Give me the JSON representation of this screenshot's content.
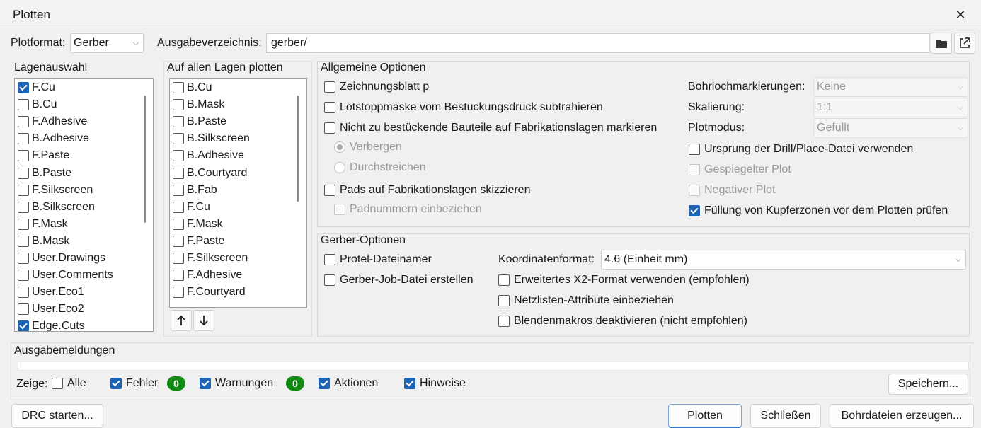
{
  "window": {
    "title": "Plotten",
    "close_glyph": "✕"
  },
  "header": {
    "plotformat_label": "Plotformat:",
    "plotformat_value": "Gerber",
    "ausgabe_label": "Ausgabeverzeichnis:",
    "ausgabe_value": "gerber/",
    "folder_icon": "folder-icon",
    "open_icon": "external-link-icon"
  },
  "lagenauswahl": {
    "heading": "Lagenauswahl",
    "items": [
      {
        "label": "F.Cu",
        "checked": true
      },
      {
        "label": "B.Cu",
        "checked": false
      },
      {
        "label": "F.Adhesive",
        "checked": false
      },
      {
        "label": "B.Adhesive",
        "checked": false
      },
      {
        "label": "F.Paste",
        "checked": false
      },
      {
        "label": "B.Paste",
        "checked": false
      },
      {
        "label": "F.Silkscreen",
        "checked": false
      },
      {
        "label": "B.Silkscreen",
        "checked": false
      },
      {
        "label": "F.Mask",
        "checked": false
      },
      {
        "label": "B.Mask",
        "checked": false
      },
      {
        "label": "User.Drawings",
        "checked": false
      },
      {
        "label": "User.Comments",
        "checked": false
      },
      {
        "label": "User.Eco1",
        "checked": false
      },
      {
        "label": "User.Eco2",
        "checked": false
      },
      {
        "label": "Edge.Cuts",
        "checked": true
      }
    ]
  },
  "alle_lagen": {
    "heading": "Auf allen Lagen plotten",
    "items": [
      {
        "label": "B.Cu",
        "checked": false
      },
      {
        "label": "B.Mask",
        "checked": false
      },
      {
        "label": "B.Paste",
        "checked": false
      },
      {
        "label": "B.Silkscreen",
        "checked": false
      },
      {
        "label": "B.Adhesive",
        "checked": false
      },
      {
        "label": "B.Courtyard",
        "checked": false
      },
      {
        "label": "B.Fab",
        "checked": false
      },
      {
        "label": "F.Cu",
        "checked": false
      },
      {
        "label": "F.Mask",
        "checked": false
      },
      {
        "label": "F.Paste",
        "checked": false
      },
      {
        "label": "F.Silkscreen",
        "checked": false
      },
      {
        "label": "F.Adhesive",
        "checked": false
      },
      {
        "label": "F.Courtyard",
        "checked": false
      }
    ],
    "up_icon": "arrow-up-icon",
    "down_icon": "arrow-down-icon"
  },
  "allgemein": {
    "heading": "Allgemeine Optionen",
    "zeichnungsblatt": "Zeichnungsblatt p",
    "loetstopp": "Lötstoppmaske vom Bestückungsdruck subtrahieren",
    "nicht_bestueckend": "Nicht zu bestückende Bauteile auf Fabrikationslagen markieren",
    "verbergen": "Verbergen",
    "durchstreichen": "Durchstreichen",
    "pads_skizzieren": "Pads auf Fabrikationslagen skizzieren",
    "padnummern": "Padnummern einbeziehen",
    "bohrloch_label": "Bohrlochmarkierungen:",
    "bohrloch_value": "Keine",
    "skalierung_label": "Skalierung:",
    "skalierung_value": "1:1",
    "plotmodus_label": "Plotmodus:",
    "plotmodus_value": "Gefüllt",
    "ursprung": "Ursprung der Drill/Place-Datei verwenden",
    "gespiegelt": "Gespiegelter Plot",
    "negativ": "Negativer Plot",
    "fuellung": "Füllung von Kupferzonen vor dem Plotten prüfen"
  },
  "gerber": {
    "heading": "Gerber-Optionen",
    "protel": "Protel-Dateinamer",
    "job_datei": "Gerber-Job-Datei erstellen",
    "koord_label": "Koordinatenformat:",
    "koord_value": "4.6 (Einheit mm)",
    "x2": "Erweitertes X2-Format verwenden (empfohlen)",
    "netzlisten": "Netzlisten-Attribute einbeziehen",
    "blenden": "Blendenmakros deaktivieren (nicht empfohlen)"
  },
  "meldungen": {
    "heading": "Ausgabemeldungen",
    "zeige_label": "Zeige:",
    "alle": "Alle",
    "fehler": "Fehler",
    "fehler_count": "0",
    "warnungen": "Warnungen",
    "warnungen_count": "0",
    "aktionen": "Aktionen",
    "hinweise": "Hinweise",
    "speichern": "Speichern..."
  },
  "footer": {
    "drc": "DRC starten...",
    "plotten": "Plotten",
    "schliessen": "Schließen",
    "bohrdateien": "Bohrdateien erzeugen..."
  },
  "colors": {
    "accent": "#1f63b5",
    "badge": "#118a11"
  }
}
